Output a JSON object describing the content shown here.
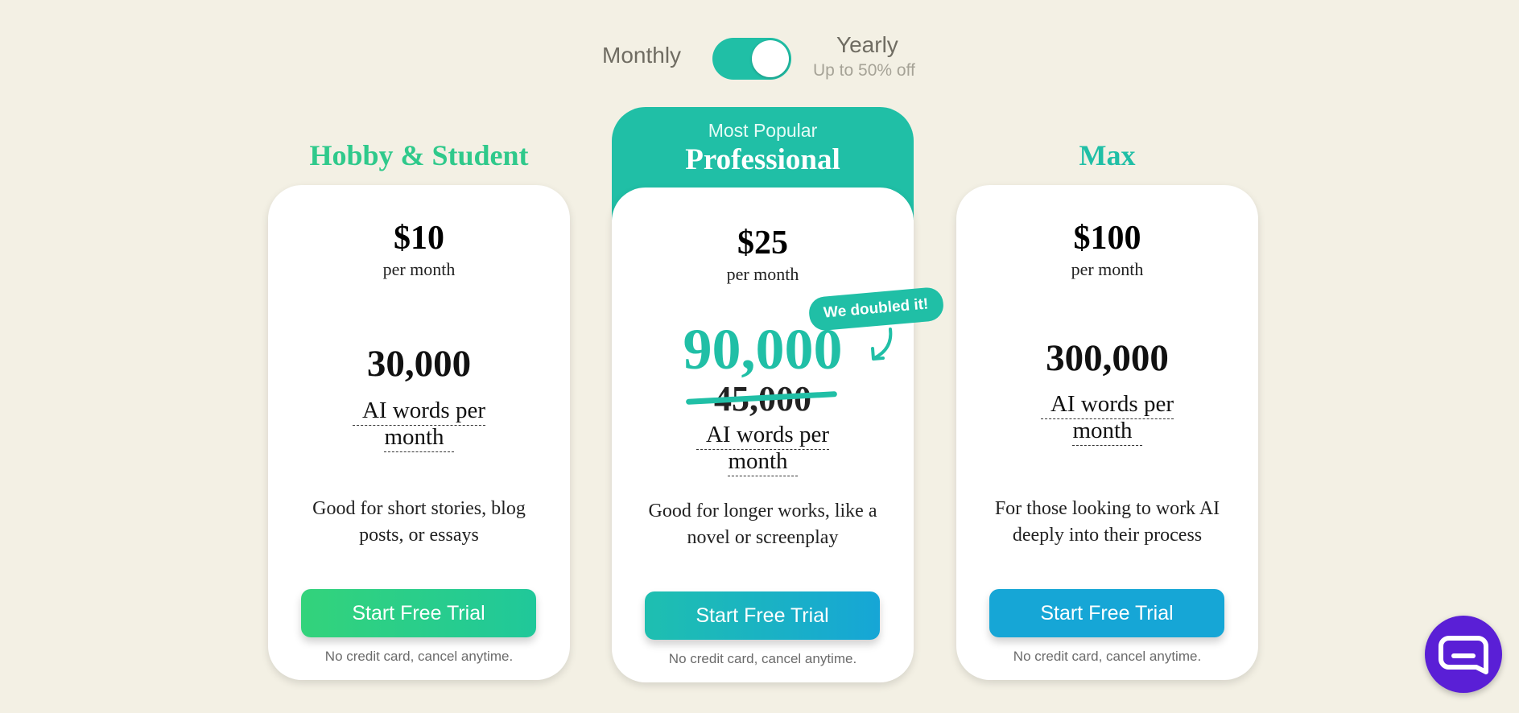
{
  "billing": {
    "monthly_label": "Monthly",
    "yearly_label": "Yearly",
    "yearly_discount": "Up to 50% off",
    "selected": "Yearly"
  },
  "plans": [
    {
      "title": "Hobby & Student",
      "price": "$10",
      "period": "per month",
      "words": "30,000",
      "words_unit": "AI words per month",
      "description": "Good for short stories, blog posts, or essays",
      "cta": "Start Free Trial",
      "note": "No credit card, cancel anytime."
    },
    {
      "banner": "Most Popular",
      "title": "Professional",
      "price": "$25",
      "period": "per month",
      "words": "90,000",
      "old_words": "45,000",
      "badge": "We doubled it!",
      "words_unit": "AI words per month",
      "description": "Good for longer works, like a novel or screenplay",
      "cta": "Start Free Trial",
      "note": "No credit card, cancel anytime."
    },
    {
      "title": "Max",
      "price": "$100",
      "period": "per month",
      "words": "300,000",
      "words_unit": "AI words per month",
      "description": "For those looking to work AI deeply into their process",
      "cta": "Start Free Trial",
      "note": "No credit card, cancel anytime."
    }
  ],
  "colors": {
    "accent_teal": "#20bfa6",
    "accent_green": "#2fc98b",
    "accent_blue": "#16a6d6",
    "chat_purple": "#5a1fd6",
    "background": "#f3f0e4"
  },
  "icons": {
    "chat": "chat-bubble-icon",
    "arrow": "curved-arrow-icon"
  }
}
